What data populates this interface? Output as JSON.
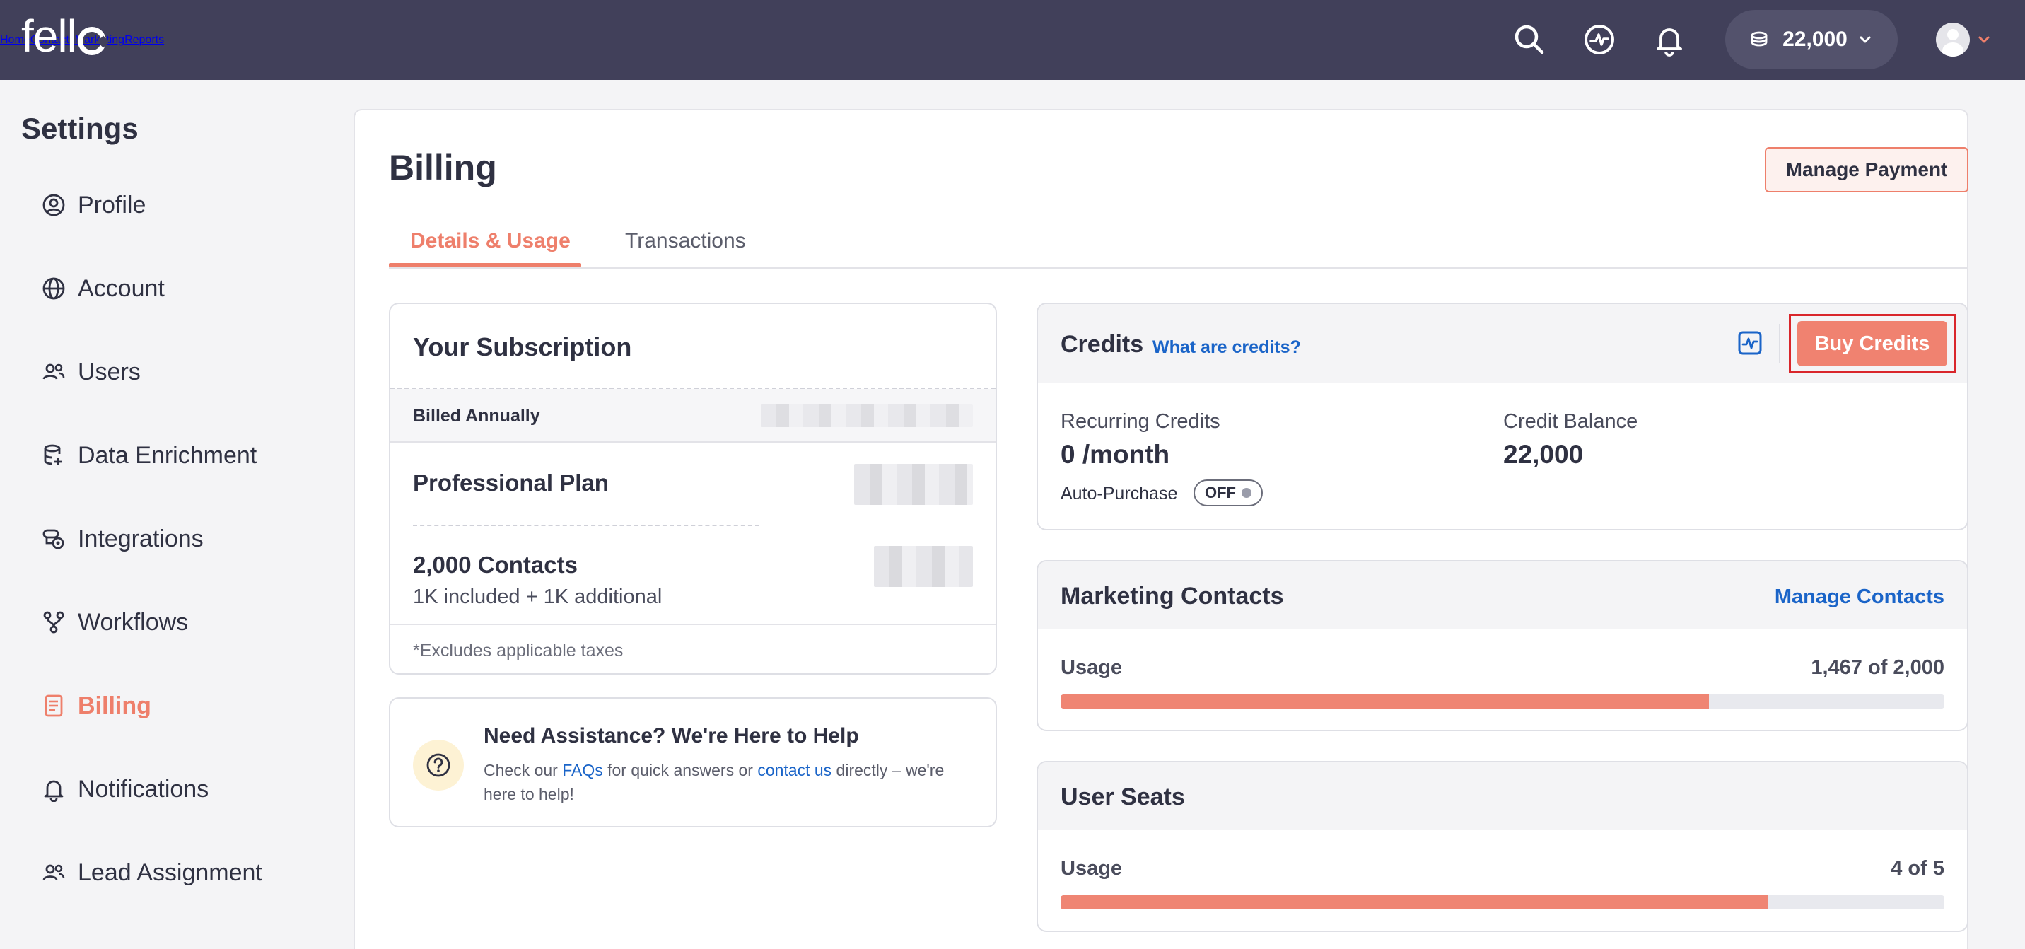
{
  "topbar": {
    "logo": "fell",
    "nav": [
      "Home",
      "Contacts",
      "Marketing",
      "Reports"
    ],
    "credits": "22,000",
    "colors": {
      "bar": "#41405a",
      "accent": "#ee7f6b"
    }
  },
  "sidebar": {
    "title": "Settings",
    "items": [
      {
        "label": "Profile",
        "icon": "user-circle-icon"
      },
      {
        "label": "Account",
        "icon": "globe-icon"
      },
      {
        "label": "Users",
        "icon": "users-icon"
      },
      {
        "label": "Data Enrichment",
        "icon": "database-icon"
      },
      {
        "label": "Integrations",
        "icon": "integrations-icon"
      },
      {
        "label": "Workflows",
        "icon": "workflow-icon"
      },
      {
        "label": "Billing",
        "icon": "document-icon",
        "active": true
      },
      {
        "label": "Notifications",
        "icon": "bell-icon"
      },
      {
        "label": "Lead Assignment",
        "icon": "lead-users-icon"
      }
    ]
  },
  "billing": {
    "title": "Billing",
    "manage_payment": "Manage Payment",
    "tabs": [
      "Details & Usage",
      "Transactions"
    ],
    "subscription": {
      "title": "Your Subscription",
      "billed": "Billed Annually",
      "plan": "Professional Plan",
      "contacts": "2,000 Contacts",
      "contacts_sub": "1K included + 1K additional",
      "footnote": "*Excludes applicable taxes"
    },
    "help": {
      "title": "Need Assistance? We're Here to Help",
      "text_before": "Check our ",
      "faqs": "FAQs",
      "text_mid": " for quick answers or ",
      "contact": "contact us",
      "text_after": " directly – we're here to help!"
    },
    "credits": {
      "title": "Credits",
      "what": "What are credits?",
      "buy": "Buy Credits",
      "recurring_label": "Recurring Credits",
      "recurring_value": "0 /month",
      "auto_purchase": "Auto-Purchase",
      "toggle": "OFF",
      "balance_label": "Credit Balance",
      "balance_value": "22,000"
    },
    "marketing_contacts": {
      "title": "Marketing Contacts",
      "manage": "Manage Contacts",
      "usage_label": "Usage",
      "usage_text": "1,467 of 2,000",
      "used": 1467,
      "total": 2000
    },
    "user_seats": {
      "title": "User Seats",
      "usage_label": "Usage",
      "usage_text": "4 of 5",
      "used": 4,
      "total": 5
    }
  }
}
